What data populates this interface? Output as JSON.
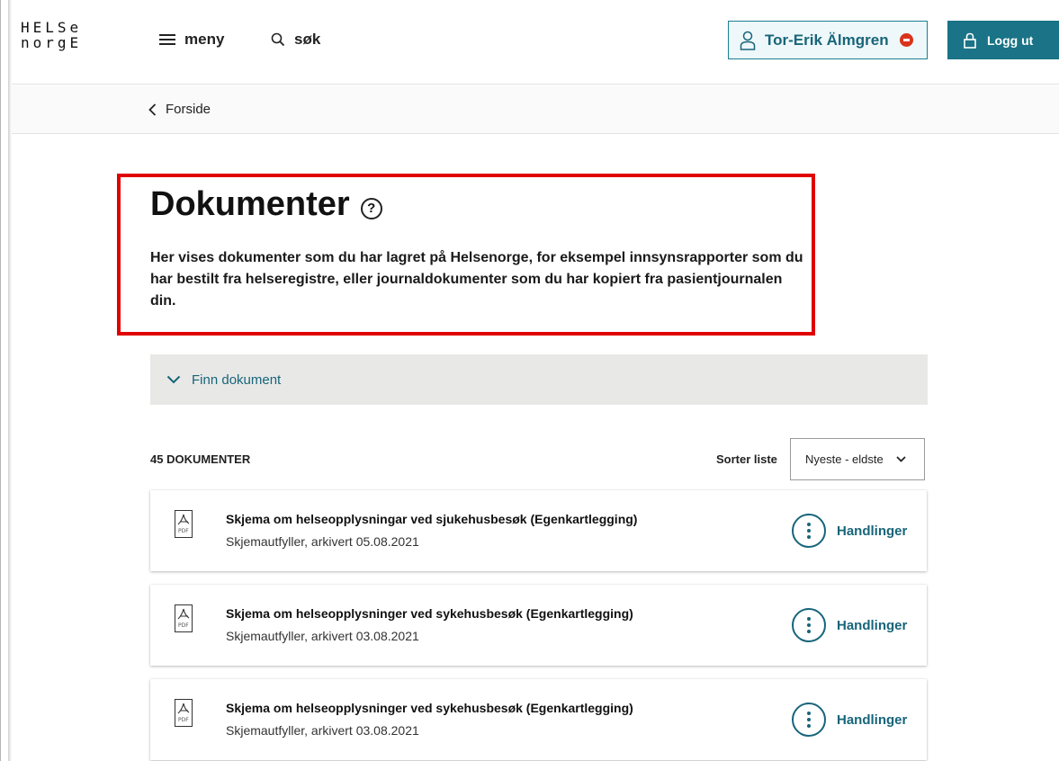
{
  "header": {
    "logo_line1": "HELSe",
    "logo_line2": "norgE",
    "menu_label": "meny",
    "search_label": "søk",
    "user_name": "Tor-Erik Älmgren",
    "logout_label": "Logg ut"
  },
  "breadcrumb": {
    "label": "Forside"
  },
  "page": {
    "title": "Dokumenter",
    "help_symbol": "?",
    "intro": "Her vises dokumenter som du har lagret på Helsenorge, for eksempel innsynsrapporter som du har bestilt fra helseregistre, eller journaldokumenter som du har kopiert fra pasientjournalen din."
  },
  "find": {
    "label": "Finn dokument"
  },
  "list": {
    "count_label": "45 DOKUMENTER",
    "sort_label": "Sorter liste",
    "sort_value": "Nyeste - eldste",
    "file_type": "PDF",
    "actions_label": "Handlinger",
    "items": [
      {
        "title": "Skjema om helseopplysningar ved sjukehusbesøk (Egenkartlegging)",
        "subtitle": "Skjemautfyller, arkivert 05.08.2021"
      },
      {
        "title": "Skjema om helseopplysninger ved sykehusbesøk (Egenkartlegging)",
        "subtitle": "Skjemautfyller, arkivert 03.08.2021"
      },
      {
        "title": "Skjema om helseopplysninger ved sykehusbesøk (Egenkartlegging)",
        "subtitle": "Skjemautfyller, arkivert 03.08.2021"
      }
    ]
  },
  "colors": {
    "accent": "#17657a",
    "logout_bg": "#1a7386",
    "highlight_border": "#e00000",
    "notification_dot": "#d9331c"
  },
  "icons": {
    "menu": "hamburger-icon",
    "search": "search-icon",
    "user": "user-icon",
    "lock": "lock-icon",
    "back": "chevron-left-icon",
    "expand": "chevron-down-icon",
    "document": "pdf-file-icon",
    "actions": "more-vertical-icon"
  }
}
